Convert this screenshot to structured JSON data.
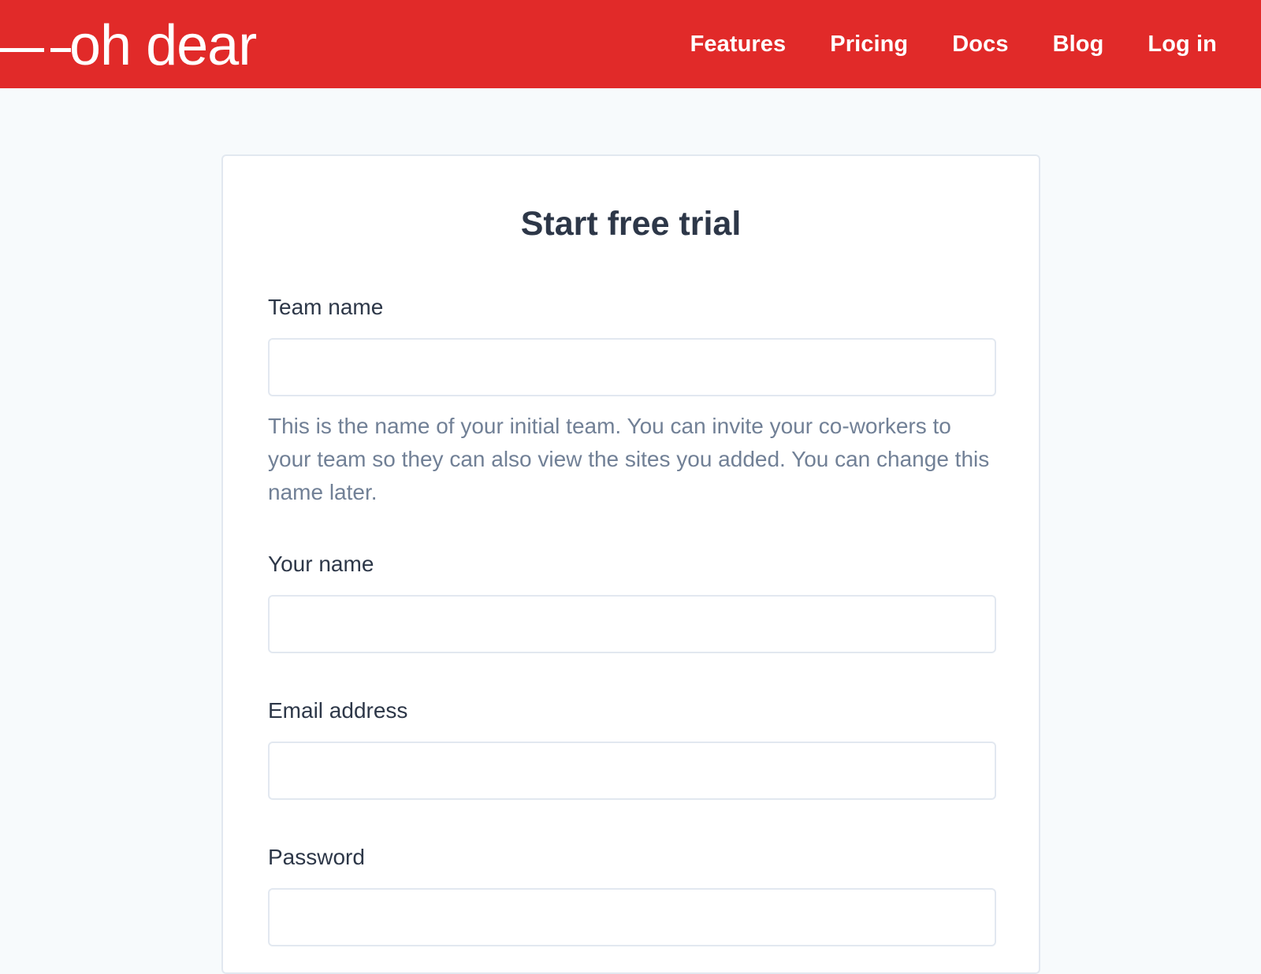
{
  "brand": {
    "name": "oh dear",
    "color": "#e12a29"
  },
  "nav": {
    "items": [
      {
        "label": "Features"
      },
      {
        "label": "Pricing"
      },
      {
        "label": "Docs"
      },
      {
        "label": "Blog"
      },
      {
        "label": "Log in"
      }
    ]
  },
  "form": {
    "title": "Start free trial",
    "fields": [
      {
        "label": "Team name",
        "value": "",
        "help": "This is the name of your initial team. You can invite your co-workers to your team so they can also view the sites you added. You can change this name later."
      },
      {
        "label": "Your name",
        "value": ""
      },
      {
        "label": "Email address",
        "value": ""
      },
      {
        "label": "Password",
        "value": ""
      }
    ]
  }
}
